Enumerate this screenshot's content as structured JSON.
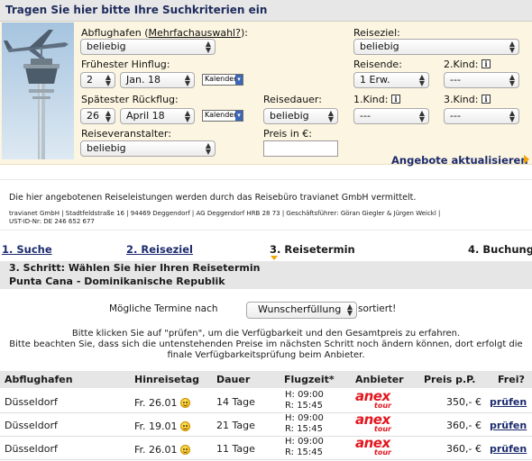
{
  "search": {
    "title": "Tragen Sie hier bitte Ihre Suchkriterien ein",
    "departure_label_pre": "Abflughafen (",
    "departure_label_link": "Mehrfachauswahl?",
    "departure_label_post": "):",
    "departure_value": "beliebig",
    "earliest_label": "Frühester Hinflug:",
    "earliest_day": "2",
    "earliest_month": "Jan. 18",
    "latest_label": "Spätester Rückflug:",
    "latest_day": "26",
    "latest_month": "April 18",
    "calendar_label": "Kalender",
    "operator_label": "Reiseveranstalter:",
    "operator_value": "beliebig",
    "duration_label": "Reisedauer:",
    "duration_value": "beliebig",
    "price_label": "Preis in €:",
    "price_value": "",
    "destination_label": "Reiseziel:",
    "destination_value": "beliebig",
    "travelers_label": "Reisende:",
    "travelers_value": "1 Erw.",
    "child1_label": "1.Kind:",
    "child1_value": "---",
    "child2_label": "2.Kind:",
    "child2_value": "---",
    "child3_label": "3.Kind:",
    "child3_value": "---",
    "info_glyph": "i",
    "update_link": "Angebote aktualisieren"
  },
  "disclaimer": {
    "main": "Die hier angebotenen Reiseleistungen werden durch das Reisebüro travianet GmbH vermittelt.",
    "company": "travianet GmbH | Stadtfeldstraße 16 | 94469 Deggendorf | AG Deggendorf HRB 28 73 | Geschäftsführer: Göran Giegler & Jürgen Weickl |",
    "vat": "UST-ID-Nr: DE 246 652 677"
  },
  "steps": {
    "items": [
      "1. Suche",
      "2. Reiseziel",
      "3. Reisetermin",
      "4. Buchung"
    ],
    "heading": "3. Schritt: Wählen Sie hier Ihren Reisetermin",
    "destination": "Punta Cana - Dominikanische Republik"
  },
  "sort": {
    "pre": "Mögliche Termine nach",
    "value": "Wunscherfüllung",
    "post": "sortiert!"
  },
  "info_lines": [
    "Bitte klicken Sie auf \"prüfen\", um die Verfügbarkeit und den Gesamtpreis zu erfahren.",
    "Bitte beachten Sie, dass sich die untenstehenden Preise im nächsten Schritt noch ändern können, dort erfolgt die",
    "finale Verfügbarkeitsprüfung beim Anbieter."
  ],
  "table": {
    "headers": [
      "Abflughafen",
      "Hinreisetag",
      "Dauer",
      "Flugzeit*",
      "Anbieter",
      "Preis p.P.",
      "Frei?"
    ],
    "rows": [
      {
        "airport": "Düsseldorf",
        "date": "Fr. 26.01",
        "duration": "14 Tage",
        "outbound": "H: 09:00",
        "return": "R: 15:45",
        "provider_top": "anex",
        "provider_bottom": "tour",
        "price": "350,- €",
        "action": "prüfen"
      },
      {
        "airport": "Düsseldorf",
        "date": "Fr. 19.01",
        "duration": "21 Tage",
        "outbound": "H: 09:00",
        "return": "R: 15:45",
        "provider_top": "anex",
        "provider_bottom": "tour",
        "price": "360,- €",
        "action": "prüfen"
      },
      {
        "airport": "Düsseldorf",
        "date": "Fr. 26.01",
        "duration": "11 Tage",
        "outbound": "H: 09:00",
        "return": "R: 15:45",
        "provider_top": "anex",
        "provider_bottom": "tour",
        "price": "360,- €",
        "action": "prüfen"
      }
    ]
  },
  "colors": {
    "search_bg": "#fcf5e1",
    "link_blue": "#1c2b6e",
    "accent_orange": "#f0a500",
    "brand_red": "#e3161f"
  }
}
